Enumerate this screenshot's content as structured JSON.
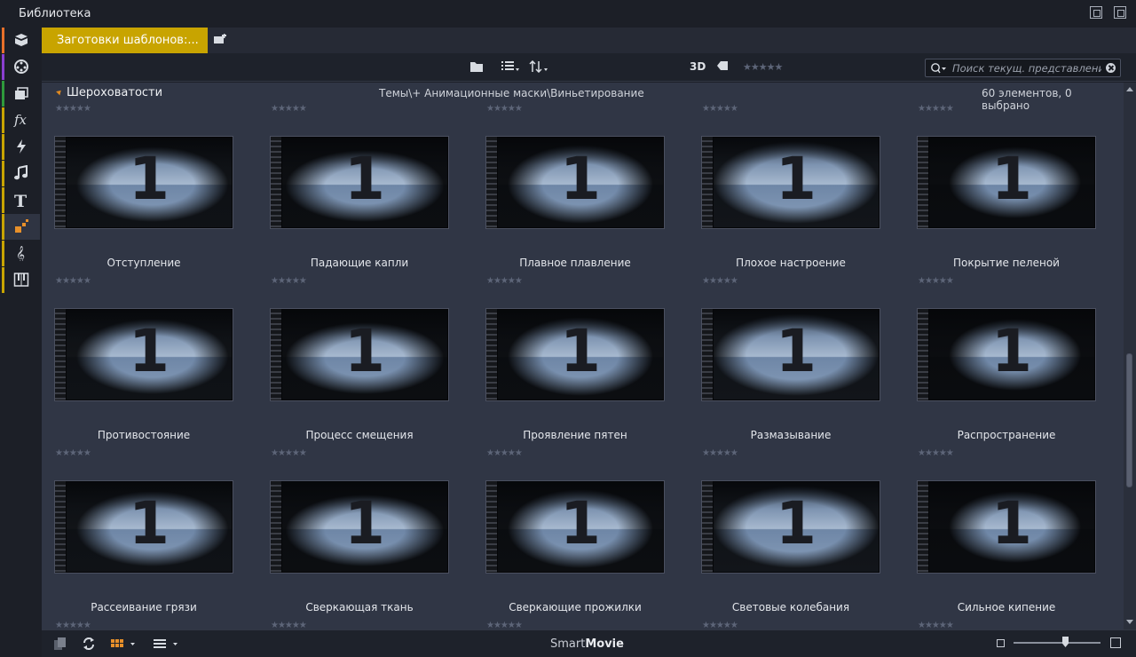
{
  "window": {
    "title": "Библиотека"
  },
  "tabs": {
    "active_label": "Заготовки шаблонов:..."
  },
  "toolbar": {
    "label_3d": "3D",
    "rating": "★★★★★",
    "search_placeholder": "Поиск текущ. представления"
  },
  "section": {
    "name": "Шероховатости",
    "path": "Темы\\+ Анимационные маски\\Виньетирование",
    "count": "60 элементов, 0 выбрано"
  },
  "rating_glyph": "★★★★★",
  "items": [
    {
      "title": "Отступление"
    },
    {
      "title": "Падающие капли"
    },
    {
      "title": "Плавное плавление"
    },
    {
      "title": "Плохое настроение"
    },
    {
      "title": "Покрытие пеленой"
    },
    {
      "title": "Противостояние"
    },
    {
      "title": "Процесс смещения"
    },
    {
      "title": "Проявление пятен"
    },
    {
      "title": "Размазывание"
    },
    {
      "title": "Распространение"
    },
    {
      "title": "Рассеивание грязи"
    },
    {
      "title": "Сверкающая ткань"
    },
    {
      "title": "Сверкающие прожилки"
    },
    {
      "title": "Световые колебания"
    },
    {
      "title": "Сильное кипение"
    }
  ],
  "thumbnail_number": "1",
  "footer": {
    "brand_light": "Smart",
    "brand_bold": "Movie"
  },
  "colors": {
    "accent_tab": "#c8a400",
    "sidebar_stripes": [
      "#e8702a",
      "#8a3fd0",
      "#2e9a3c",
      "#c8a400"
    ]
  }
}
